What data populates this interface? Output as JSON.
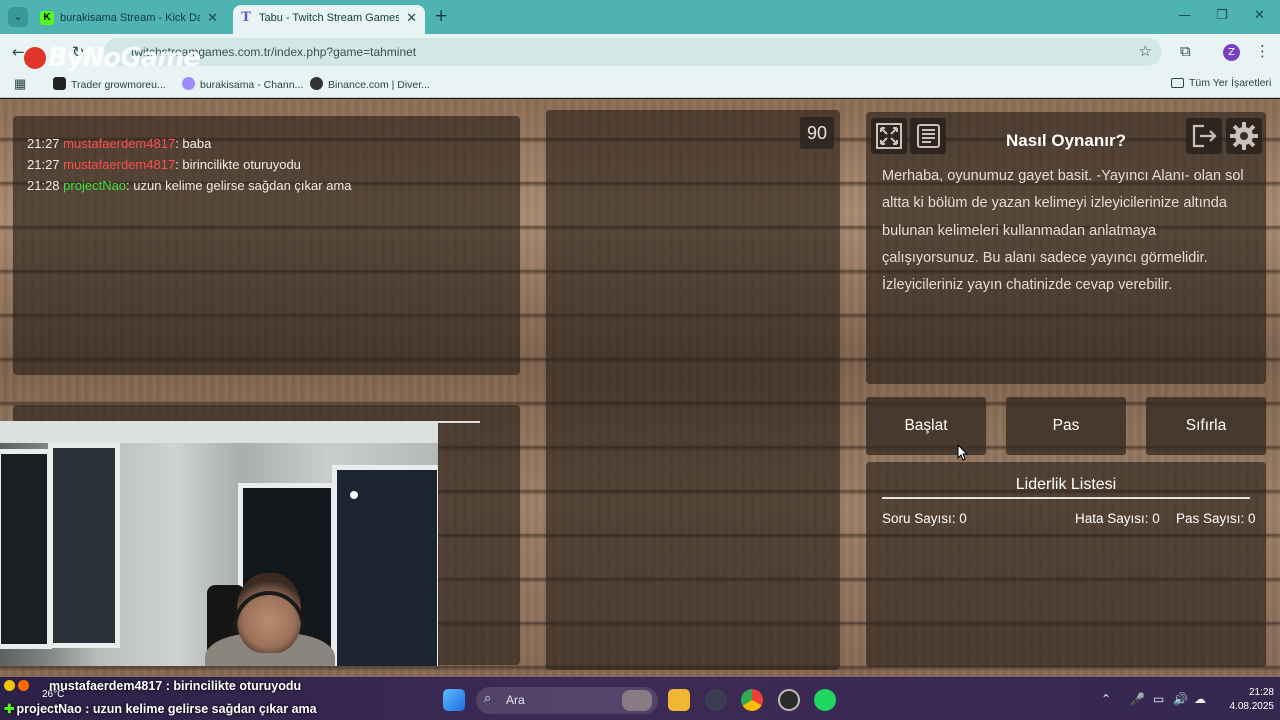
{
  "browser": {
    "tabs": [
      {
        "label": "burakisama Stream - Kick Dash",
        "active": false
      },
      {
        "label": "Tabu - Twitch Stream Games",
        "active": true
      }
    ],
    "url": "twitchstreamgames.com.tr/index.php?game=tahminet",
    "watermark": "ByNoGame",
    "bookmarks": [
      "Trader growmoreu...",
      "burakisama - Chann...",
      "Binance.com | Diver..."
    ],
    "bookmarks_folder": "Tüm Yer İşaretleri",
    "profile_letter": "Z"
  },
  "chat": {
    "messages": [
      {
        "time": "21:27",
        "user": "mustafaerdem4817",
        "text": ": baba",
        "color": "#ff4d4d"
      },
      {
        "time": "21:27",
        "user": "mustafaerdem4817",
        "text": ": birincilikte oturuyodu",
        "color": "#ff4d4d"
      },
      {
        "time": "21:28",
        "user": "projectNao",
        "text": ": uzun kelime gelirse sağdan çıkar ama",
        "color": "#3fe03f"
      }
    ]
  },
  "timer": "90",
  "how_to": {
    "title": "Nasıl Oynanır?",
    "body": "Merhaba, oyunumuz gayet basit. -Yayıncı Alanı- olan sol altta ki bölüm de yazan kelimeyi izleyicilerinize altında bulunan kelimeleri kullanmadan anlatmaya çalışıyorsunuz. Bu alanı sadece yayıncı görmelidir. İzleyicileriniz yayın chatinizde cevap verebilir."
  },
  "controls": {
    "start": "Başlat",
    "pass": "Pas",
    "reset": "Sıfırla"
  },
  "leaderboard": {
    "title": "Liderlik Listesi",
    "questions": "Soru Sayısı: 0",
    "errors": "Hata Sayısı: 0",
    "passes": "Pas Sayısı: 0"
  },
  "stream_ticker": [
    "mustafaerdem4817 : birincilikte oturuyodu",
    "projectNao : uzun kelime gelirse sağdan çıkar ama"
  ],
  "taskbar": {
    "weather": "26°C",
    "search_placeholder": "Ara",
    "time": "21:28",
    "date": "4.08.2025"
  },
  "colors": {
    "tab_bar": "#4fb3b3",
    "chat_user_red": "#ff4d4d",
    "chat_user_green": "#3fe03f"
  }
}
